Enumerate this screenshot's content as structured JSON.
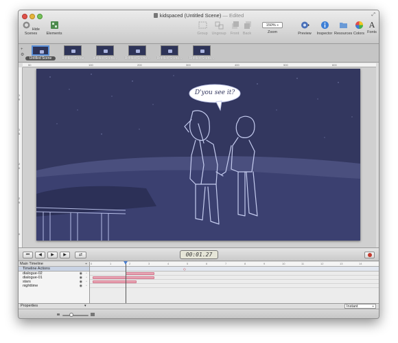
{
  "window": {
    "title": "kidspaced (Untitled Scene)",
    "edited": " — Edited"
  },
  "toolbar": {
    "hide_scenes": "Hide Scenes",
    "elements": "Elements",
    "group": "Group",
    "ungroup": "Ungroup",
    "front": "Front",
    "back": "Back",
    "zoom_value": "150% ÷",
    "zoom_label": "Zoom",
    "preview": "Preview",
    "inspector": "Inspector",
    "resources": "Resources",
    "colors": "Colors",
    "fonts": "Fonts"
  },
  "scenes": {
    "items": [
      {
        "label": "Untitled Scene"
      },
      {
        "label": "Untitled Scene"
      },
      {
        "label": "Untitled Scene..."
      },
      {
        "label": "Untitled Scene..."
      },
      {
        "label": "Untitled Scene..."
      },
      {
        "label": "Untitled Scene..."
      }
    ]
  },
  "rulers": {
    "h_ticks": [
      "50",
      "100",
      "200",
      "300",
      "400",
      "500",
      "600"
    ],
    "v_ticks": [
      "1",
      "0",
      "1",
      "5",
      "2",
      "0",
      "2",
      "5",
      "0"
    ]
  },
  "stage": {
    "speech": "D'you see it?"
  },
  "playback": {
    "timecode": "00:01.27"
  },
  "timeline": {
    "header": "Main Timeline",
    "actions": "Timeline Actions",
    "layers": [
      {
        "name": "dialogue-02"
      },
      {
        "name": "dialogue-01"
      },
      {
        "name": "stars"
      },
      {
        "name": "nighttime"
      }
    ],
    "ruler_ticks": [
      "0",
      "1",
      "2",
      "3",
      "4",
      "5",
      "6",
      "7",
      "8",
      "9",
      "10",
      "11",
      "12",
      "13",
      "14"
    ]
  },
  "properties": {
    "label": "Properties",
    "easing": "Instant"
  },
  "colors": {
    "stage_bg": "#33375f",
    "bar_fill": "#e9a4b3",
    "playhead": "#4a7fd0"
  }
}
